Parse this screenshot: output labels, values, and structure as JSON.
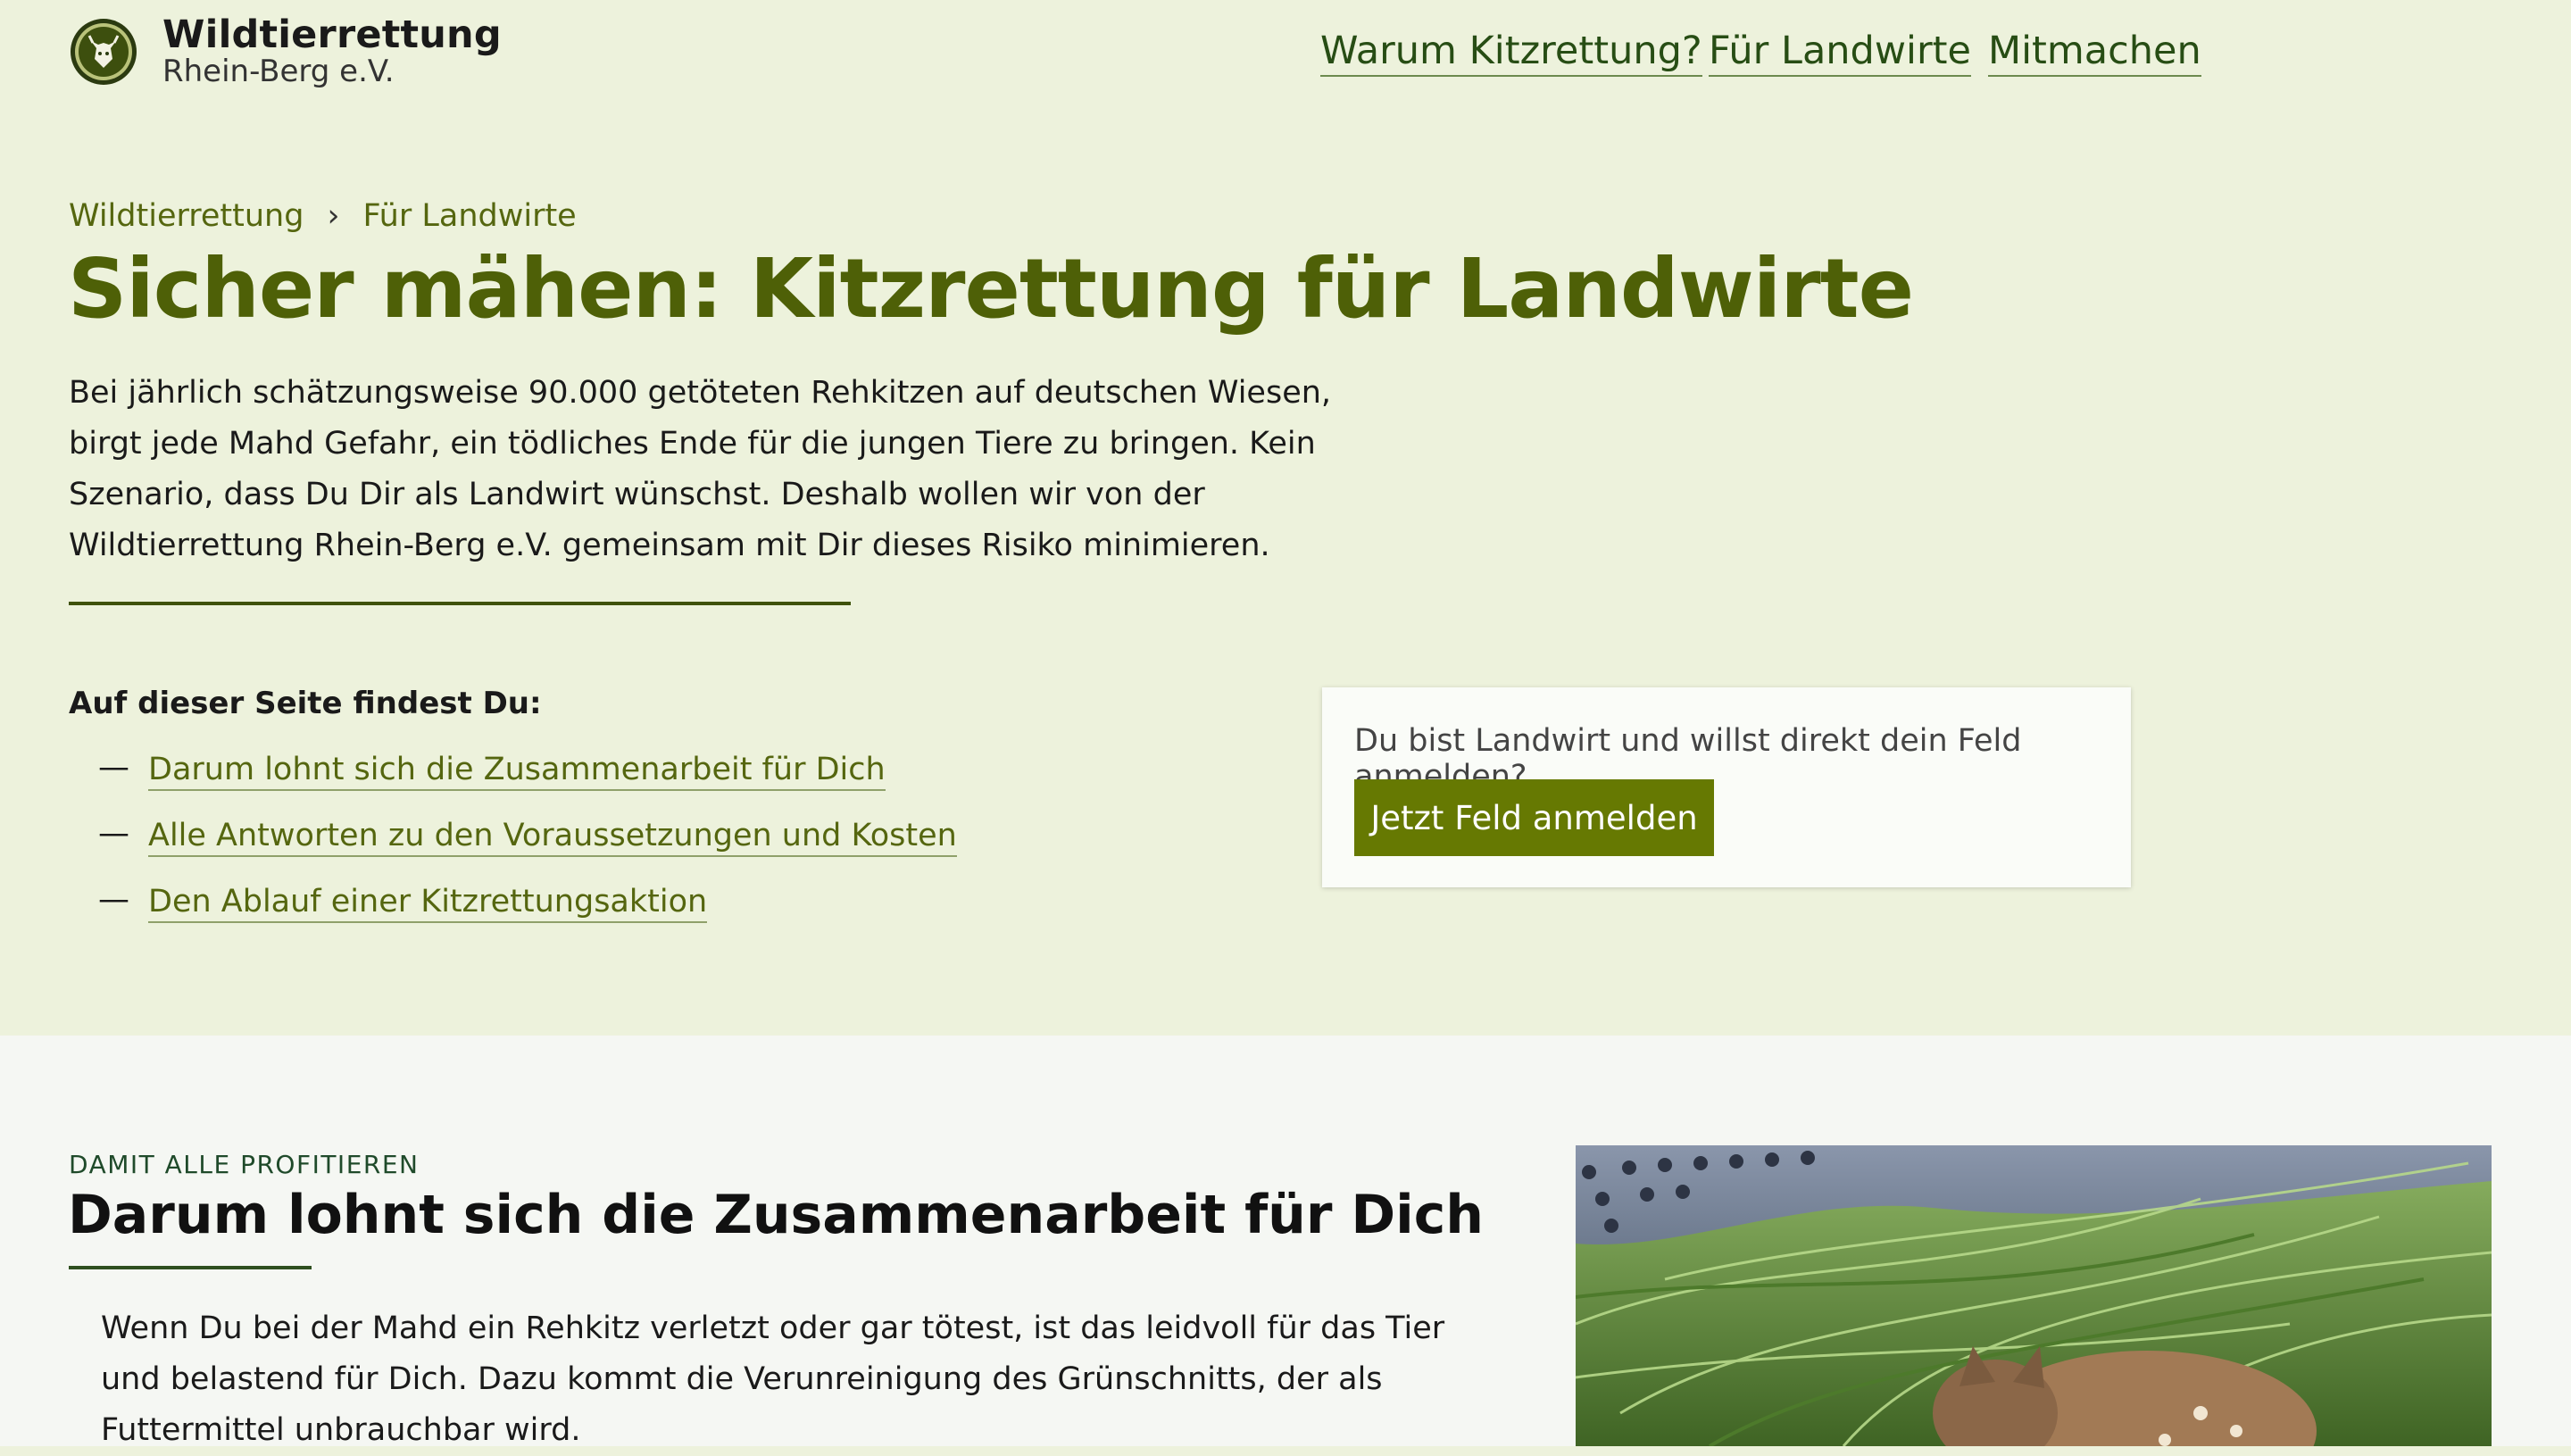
{
  "header": {
    "brand_title": "Wildtierrettung",
    "brand_subtitle": "Rhein-Berg e.V.",
    "logo_icon": "deer-head-logo-icon",
    "nav": [
      "Warum Kitzrettung?",
      "Für Landwirte",
      "Mitmachen"
    ]
  },
  "hero": {
    "breadcrumb": [
      "Wildtierrettung",
      "Für Landwirte"
    ],
    "breadcrumb_separator": "›",
    "title": "Sicher mähen: Kitzrettung für Landwirte",
    "intro": "Bei jährlich schätzungsweise 90.000 getöteten Rehkitzen auf deutschen Wiesen, birgt jede Mahd Gefahr, ein tödliches Ende für die jungen Tiere zu bringen. Kein Szenario, dass Du Dir als Landwirt wünschst. Deshalb wollen wir von der Wildtierrettung Rhein-Berg e.V. gemeinsam mit Dir dieses Risiko minimieren."
  },
  "toc": {
    "heading": "Auf dieser Seite findest Du:",
    "dash": "—",
    "items": [
      "Darum lohnt sich die Zusammenarbeit für Dich",
      "Alle Antworten zu den Voraussetzungen und Kosten",
      "Den Ablauf einer Kitzrettungsaktion"
    ]
  },
  "cta": {
    "text": "Du bist Landwirt und willst direkt dein Feld anmelden?",
    "button": "Jetzt Feld anmelden"
  },
  "section": {
    "eyebrow": "DAMIT ALLE PROFITIEREN",
    "heading": "Darum lohnt sich die Zusammenarbeit für Dich",
    "body": "Wenn Du bei der Mahd ein Rehkitz verletzt oder gar tötest, ist das leidvoll für das Tier und belastend für Dich. Dazu kommt die Verunreinigung des Grünschnitts, der als Futtermittel unbrauchbar wird."
  },
  "colors": {
    "page_bg": "#edf2dc",
    "accent": "#4e6007",
    "button": "#667902",
    "nav": "#274d14"
  }
}
